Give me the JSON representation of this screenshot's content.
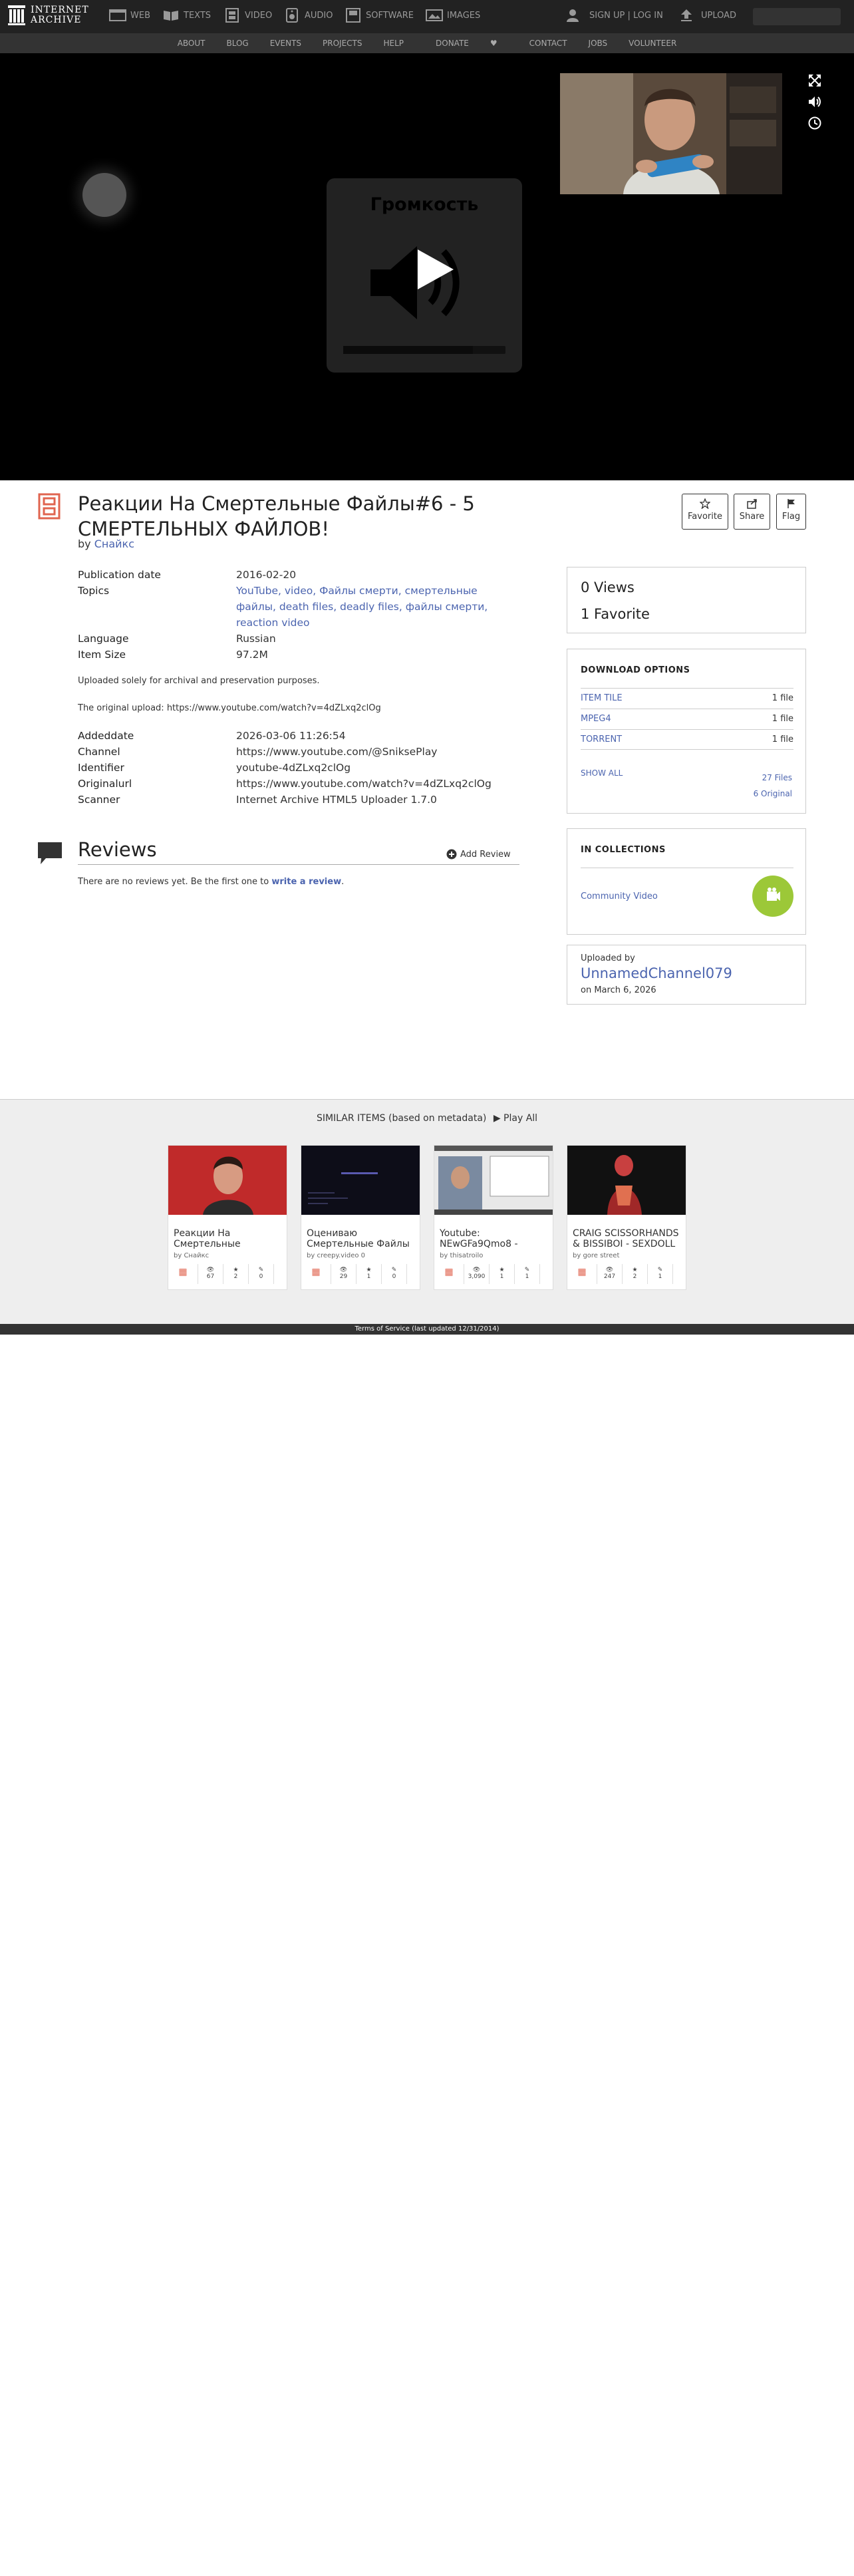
{
  "brand": {
    "line1": "INTERNET",
    "line2": "ARCHIVE"
  },
  "topnav": {
    "media": [
      {
        "label": "WEB",
        "icon": "web-icon"
      },
      {
        "label": "TEXTS",
        "icon": "texts-icon"
      },
      {
        "label": "VIDEO",
        "icon": "video-icon"
      },
      {
        "label": "AUDIO",
        "icon": "audio-icon"
      },
      {
        "label": "SOFTWARE",
        "icon": "software-icon"
      },
      {
        "label": "IMAGES",
        "icon": "images-icon"
      }
    ],
    "signup": "SIGN UP | LOG IN",
    "upload": "UPLOAD"
  },
  "subnav": [
    "ABOUT",
    "BLOG",
    "EVENTS",
    "PROJECTS",
    "HELP",
    "DONATE",
    "CONTACT",
    "JOBS",
    "VOLUNTEER"
  ],
  "player": {
    "volume_title": "Громкость",
    "volume_level": 0.8
  },
  "item": {
    "title": "Реакции На Смертельные Файлы#6 - 5 СМЕРТЕЛЬНЫХ ФАЙЛОВ!",
    "by_prefix": "by",
    "author": "Снайкс"
  },
  "actions": {
    "favorite": "Favorite",
    "share": "Share",
    "flag": "Flag"
  },
  "metadata": {
    "pubdate_label": "Publication date",
    "pubdate": "2016-02-20",
    "topics_label": "Topics",
    "topics_line1": "YouTube, video, Файлы смерти, смертельные",
    "topics_line2": "файлы, death files, deadly files, файлы смерти,",
    "topics_line3": "reaction video",
    "language_label": "Language",
    "language": "Russian",
    "size_label": "Item Size",
    "size": "97.2M",
    "desc1": "Uploaded solely for archival and preservation purposes.",
    "desc2": "The original upload: https://www.youtube.com/watch?v=4dZLxq2clOg",
    "addeddate_label": "Addeddate",
    "addeddate": "2026-03-06 11:26:54",
    "channel_label": "Channel",
    "channel": "https://www.youtube.com/@SniksePlay",
    "identifier_label": "Identifier",
    "identifier": "youtube-4dZLxq2clOg",
    "originalurl_label": "Originalurl",
    "originalurl": "https://www.youtube.com/watch?v=4dZLxq2clOg",
    "scanner_label": "Scanner",
    "scanner": "Internet Archive HTML5 Uploader 1.7.0"
  },
  "reviews": {
    "title": "Reviews",
    "add": "Add Review",
    "empty_text": "There are no reviews yet. Be the first one to",
    "empty_link": "write a review",
    "empty_end": "."
  },
  "stats": {
    "views": "0 Views",
    "favorites": "1 Favorite"
  },
  "downloads": {
    "heading": "DOWNLOAD OPTIONS",
    "rows": [
      {
        "format": "ITEM TILE",
        "count": "1 file"
      },
      {
        "format": "MPEG4",
        "count": "1 file"
      },
      {
        "format": "TORRENT",
        "count": "1 file"
      }
    ],
    "show_all": "SHOW ALL",
    "files": "27 Files",
    "original": "6 Original"
  },
  "collections": {
    "heading": "IN COLLECTIONS",
    "name": "Community Video"
  },
  "uploader": {
    "label": "Uploaded by",
    "name": "UnnamedChannel079",
    "date": "on March 6, 2026"
  },
  "similar": {
    "heading": "SIMILAR ITEMS (based on metadata)",
    "play_all": "Play All",
    "cards": [
      {
        "title": "Реакции На Смертельные",
        "by": "by Снайкс",
        "views": "67",
        "favs": "2",
        "reviews": "0"
      },
      {
        "title": "Оцениваю Смертельные Файлы",
        "by": "by creepy.video 0",
        "views": "29",
        "favs": "1",
        "reviews": "0"
      },
      {
        "title": "Youtube: NEwGFa9Qmo8 -",
        "by": "by thisatroilo",
        "views": "3,090",
        "favs": "1",
        "reviews": "1"
      },
      {
        "title": "CRAIG SCISSORHANDS & BISSIBOI - SEXDOLL",
        "by": "by gore street",
        "views": "247",
        "favs": "2",
        "reviews": "1"
      }
    ]
  },
  "footer": "Terms of Service (last updated 12/31/2014)",
  "colors": {
    "nav_bg": "#222222",
    "link": "#4b64af",
    "accent_red": "#f5333f",
    "collection_green": "#9cc838"
  }
}
